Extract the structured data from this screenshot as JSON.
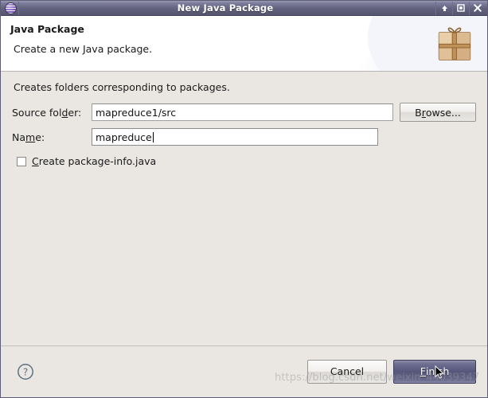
{
  "window": {
    "title": "New Java Package",
    "app_icon": "eclipse-globe-icon",
    "controls": {
      "shade_label": "▲",
      "maximize_label": "□",
      "close_label": "✕"
    }
  },
  "banner": {
    "title": "Java Package",
    "subtitle": "Create a new Java package.",
    "icon": "gift-package-icon"
  },
  "form": {
    "description": "Creates folders corresponding to packages.",
    "source_folder": {
      "label_before": "Source fol",
      "label_mnemonic": "d",
      "label_after": "er:",
      "value": "mapreduce1/src",
      "placeholder": ""
    },
    "browse_button": {
      "label_before": "B",
      "label_mnemonic": "r",
      "label_after": "owse..."
    },
    "name": {
      "label_before": "Na",
      "label_mnemonic": "m",
      "label_after": "e:",
      "value": "mapreduce",
      "placeholder": ""
    },
    "package_info_checkbox": {
      "checked": false,
      "label_before": "",
      "label_mnemonic": "C",
      "label_after": "reate package-info.java"
    }
  },
  "footer": {
    "help_icon": "help-question-icon",
    "cancel_button": "Cancel",
    "finish_button": {
      "label_before": "",
      "label_mnemonic": "F",
      "label_after": "inish"
    }
  },
  "watermark": "https://blog.csdn.net/weixin_44039347",
  "colors": {
    "titlebar": "#62627f",
    "body_background": "#eae7e3",
    "banner_background": "#ffffff",
    "finish_button": "#56567a",
    "field_background": "#ffffff"
  }
}
